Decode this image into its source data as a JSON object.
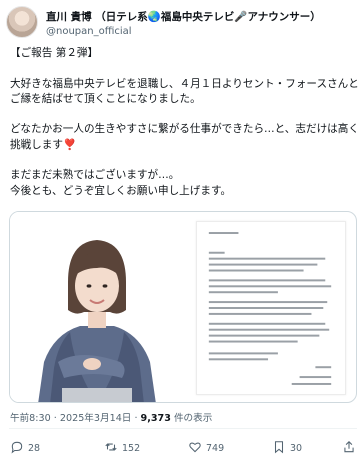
{
  "post": {
    "author_name": "直川 貴博 （日テレ系🌏福島中央テレビ🎤アナウンサー）",
    "handle": "@noupan_official",
    "lines": [
      "【ご報告 第２弾】",
      "",
      "大好きな福島中央テレビを退職し、４月１日よりセント・フォースさんと",
      "ご縁を結ばせて頂くことになりました。",
      "",
      "どなたかお一人の生きやすさに繋がる仕事ができたら…と、志だけは高く",
      "挑戦します",
      "",
      "まだまだ未熟ではございますが…。",
      "今後とも、どうぞ宜しくお願い申し上げます。"
    ],
    "heart_emoji": "❣️",
    "timestamp": "午前8:30 · 2025年3月14日 · ",
    "views_count": "9,373",
    "views_label": " 件の表示"
  },
  "actions": {
    "reply_count": "28",
    "repost_count": "152",
    "like_count": "749",
    "bookmark_count": "30"
  },
  "colors": {
    "text": "#0f1419",
    "muted": "#536471",
    "heart": "#e0245e",
    "border": "#cfd9de"
  }
}
